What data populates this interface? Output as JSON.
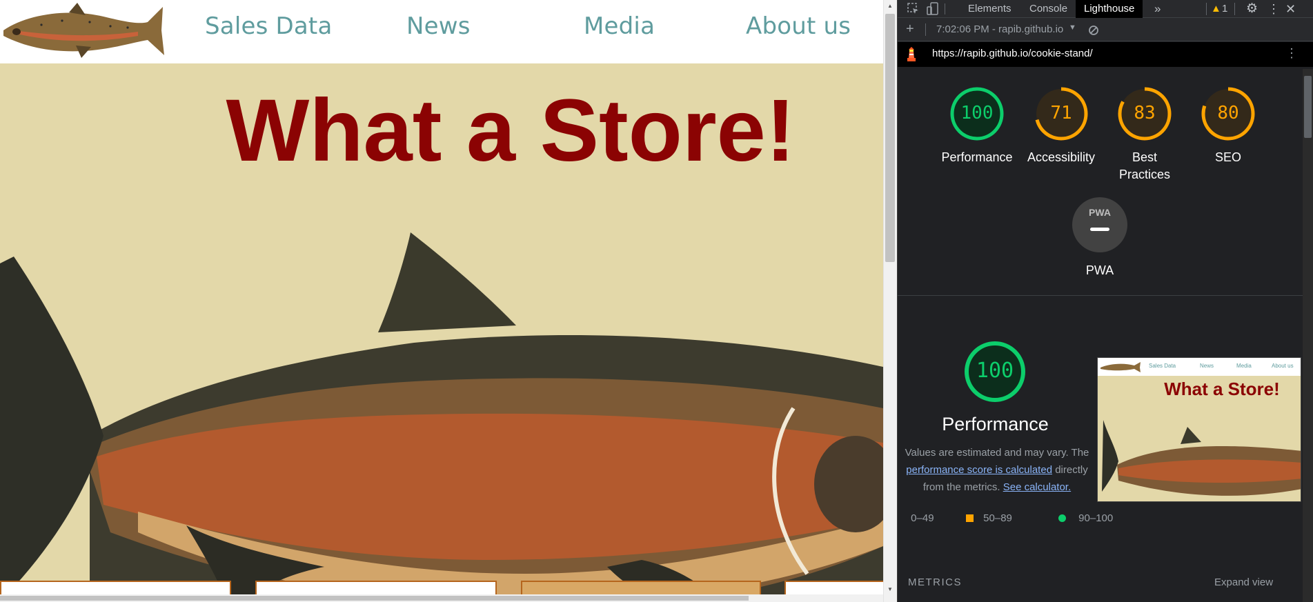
{
  "site": {
    "nav": {
      "links": [
        "Sales Data",
        "News",
        "Media",
        "About us"
      ]
    },
    "hero_title": "What a Store!"
  },
  "devtools": {
    "tabs": [
      "Elements",
      "Console",
      "Lighthouse"
    ],
    "active_tab": "Lighthouse",
    "more_tabs_icon": "»",
    "warning_count": "1",
    "report_time": "7:02:06 PM - rapib.github.io",
    "url": "https://rapib.github.io/cookie-stand/",
    "scores": [
      {
        "label": "Performance",
        "value": "100",
        "color": "#0cce6b"
      },
      {
        "label": "Accessibility",
        "value": "71",
        "color": "#ffa400"
      },
      {
        "label": "Best Practices",
        "value": "83",
        "color": "#ffa400"
      },
      {
        "label": "SEO",
        "value": "80",
        "color": "#ffa400"
      }
    ],
    "pwa": {
      "label": "PWA",
      "badge_text": "PWA"
    },
    "performance_section": {
      "score": "100",
      "title": "Performance",
      "desc_start": "Values are estimated and may vary. The",
      "desc_link": "performance score is calculated",
      "desc_middle": "directly from the",
      "desc_end": "metrics.",
      "calc_link": "See calculator."
    },
    "legend": [
      {
        "range": "0–49",
        "color": "#ff4e42"
      },
      {
        "range": "50–89",
        "color": "#ffa400"
      },
      {
        "range": "90–100",
        "color": "#0cce6b"
      }
    ],
    "thumbnail": {
      "nav": [
        "Sales Data",
        "News",
        "Media",
        "About us"
      ],
      "title": "What a Store!"
    },
    "metrics_heading": "METRICS",
    "expand_label": "Expand view"
  }
}
